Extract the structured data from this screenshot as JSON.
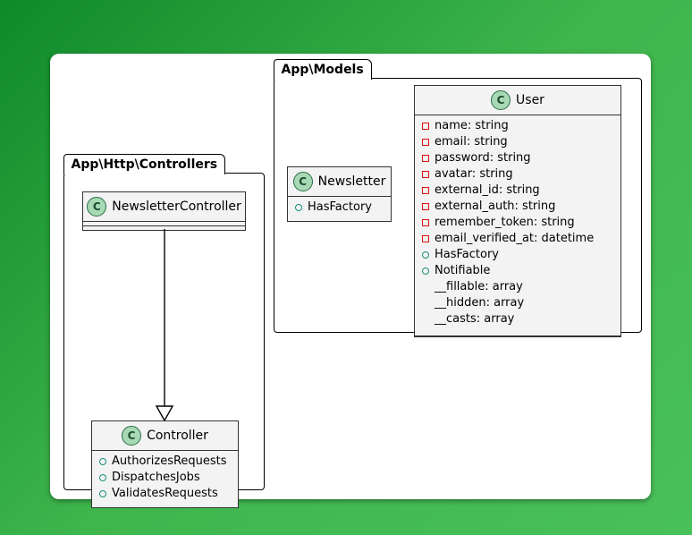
{
  "packages": {
    "controllers": {
      "title": "App\\Http\\Controllers"
    },
    "models": {
      "title": "App\\Models"
    }
  },
  "classes": {
    "newsletterController": {
      "badge": "C",
      "name": "NewsletterController",
      "members": []
    },
    "controller": {
      "badge": "C",
      "name": "Controller",
      "members": [
        {
          "sym": "circle-teal",
          "label": "AuthorizesRequests"
        },
        {
          "sym": "circle-teal",
          "label": "DispatchesJobs"
        },
        {
          "sym": "circle-teal",
          "label": "ValidatesRequests"
        }
      ]
    },
    "newsletter": {
      "badge": "C",
      "name": "Newsletter",
      "members": [
        {
          "sym": "circle-teal",
          "label": "HasFactory"
        }
      ]
    },
    "user": {
      "badge": "C",
      "name": "User",
      "members": [
        {
          "sym": "square-red",
          "label": "name: string"
        },
        {
          "sym": "square-red",
          "label": "email: string"
        },
        {
          "sym": "square-red",
          "label": "password: string"
        },
        {
          "sym": "square-red",
          "label": "avatar: string"
        },
        {
          "sym": "square-red",
          "label": "external_id: string"
        },
        {
          "sym": "square-red",
          "label": "external_auth: string"
        },
        {
          "sym": "square-red",
          "label": "remember_token: string"
        },
        {
          "sym": "square-red",
          "label": "email_verified_at: datetime"
        },
        {
          "sym": "circle-teal",
          "label": "HasFactory"
        },
        {
          "sym": "circle-teal",
          "label": "Notifiable"
        },
        {
          "sym": "none",
          "label": "__fillable: array"
        },
        {
          "sym": "none",
          "label": "__hidden: array"
        },
        {
          "sym": "none",
          "label": "__casts: array"
        }
      ]
    }
  }
}
